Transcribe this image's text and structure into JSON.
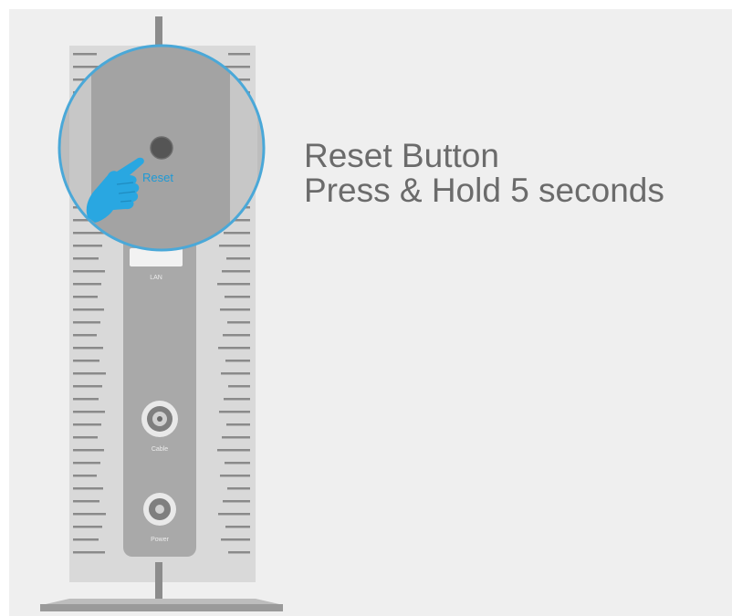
{
  "instruction": {
    "title": "Reset Button",
    "detail": "Press & Hold 5 seconds"
  },
  "device": {
    "reset_label": "Reset",
    "lan_label": "LAN",
    "cable_label": "Cable",
    "power_label": "Power",
    "icons": [
      "hand-pointer-icon",
      "reset-button-icon",
      "coax-port-icon",
      "power-port-icon"
    ]
  },
  "colors": {
    "background": "#efefef",
    "highlight_ring": "#4aa8d8",
    "hand": "#29a7e1",
    "reset_label": "#1e9ad6",
    "text": "#6b6b6b"
  }
}
